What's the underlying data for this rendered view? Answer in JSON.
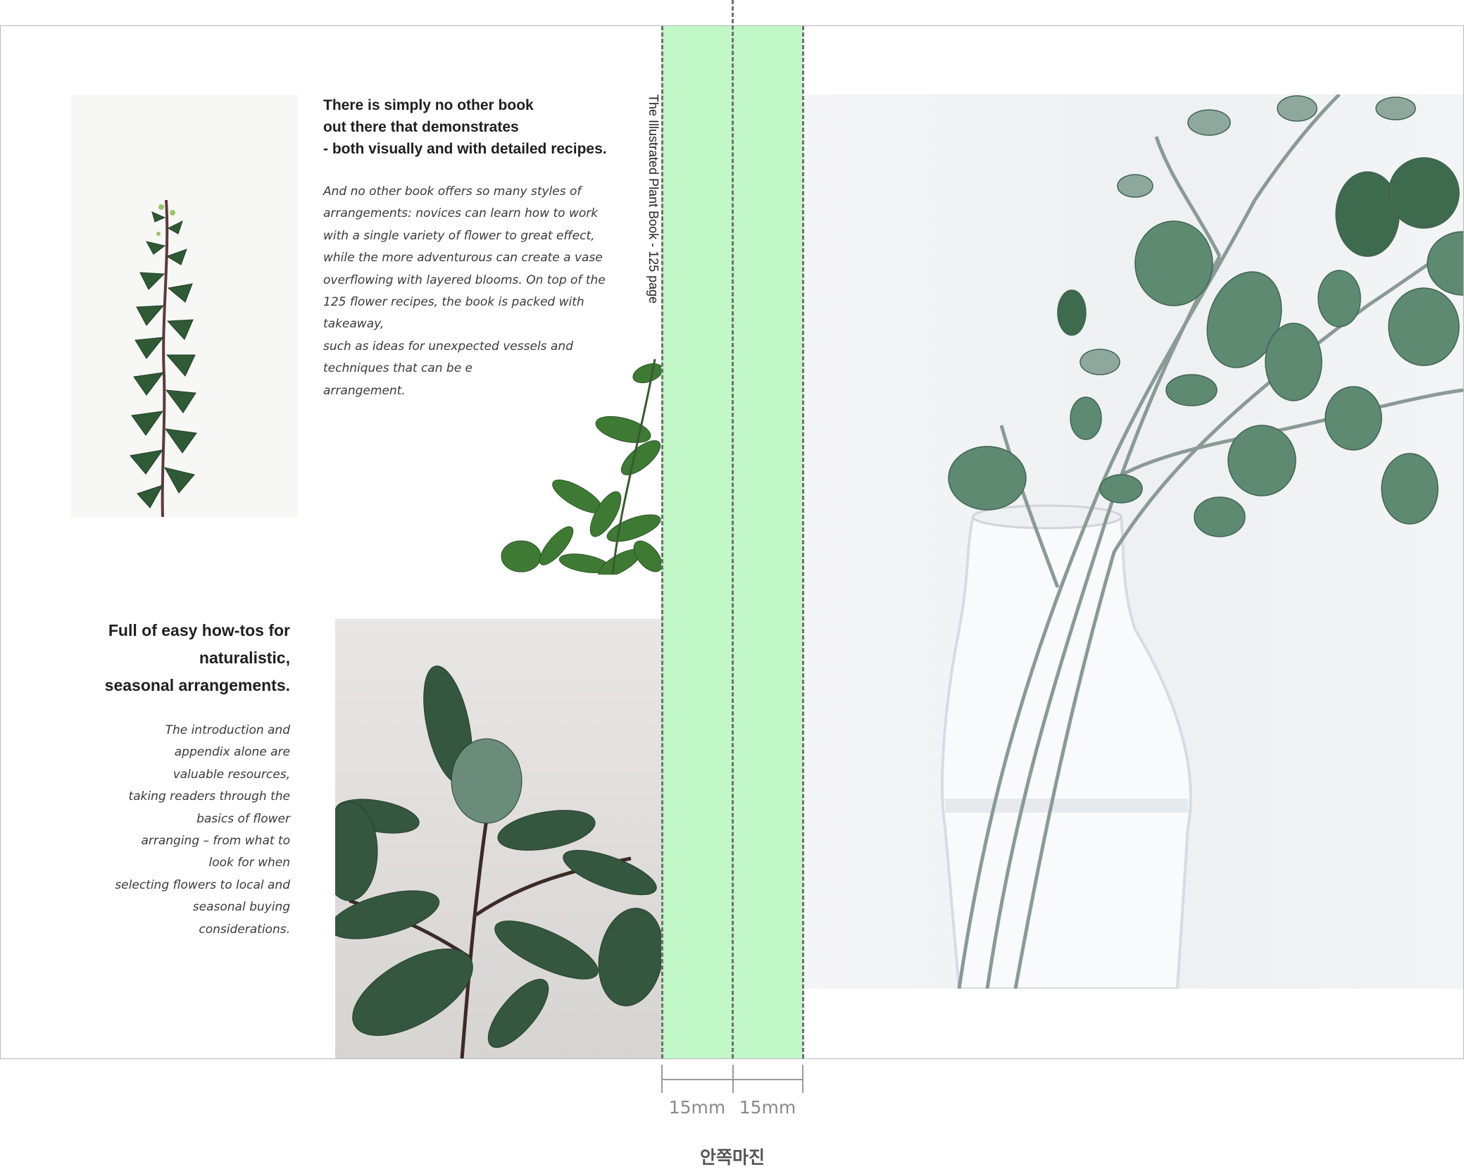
{
  "left_page": {
    "block_top": {
      "heading_lines": [
        "There is simply no other book",
        "out there that demonstrates",
        "- both visually and with detailed recipes."
      ],
      "body_lines": [
        "And no other book offers so many styles of",
        "arrangements: novices can learn how to work",
        "with a single variety of flower to great effect,",
        "while the more adventurous can create a vase",
        "overflowing with layered blooms. On top of the",
        "125 flower recipes, the book is packed with",
        "takeaway,",
        "such as ideas for unexpected vessels and",
        "techniques that can be employed to elevate any",
        "arrangement."
      ]
    },
    "block_bottom": {
      "heading_lines": [
        "Full of easy how-tos for",
        "naturalistic,",
        "seasonal arrangements."
      ],
      "body_lines": [
        "The introduction and",
        "appendix alone are",
        "valuable resources,",
        "taking readers through the",
        "basics of flower",
        "arranging – from what to",
        "look for when",
        "selecting flowers to local and",
        "seasonal buying",
        "considerations."
      ]
    },
    "spine_label": "The Illustrated Plant Book - 125 page"
  },
  "dimensions": {
    "left_margin": "15mm",
    "right_margin": "15mm",
    "caption": "안쪽마진"
  },
  "colors": {
    "margin_band": "#c2f7c8",
    "leaf_dark": "#2f5a35",
    "eucalyptus": "#5f8a72"
  }
}
